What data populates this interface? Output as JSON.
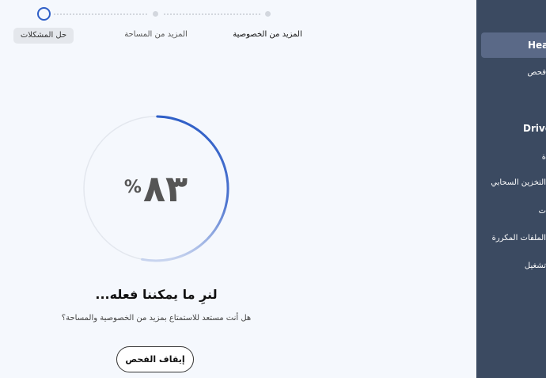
{
  "stepper": {
    "steps": [
      {
        "label": "حل المشكلات"
      },
      {
        "label": "المزيد من المساحة"
      },
      {
        "label": "المزيد من الخصوصية"
      }
    ]
  },
  "scan": {
    "percent_value": "83",
    "percent_display": "٨٣",
    "percent_sign": "%",
    "progress": 0.83,
    "headline": "لنرِ ما يمكننا فعله...",
    "subline": "هل أنت مستعد للاستمتاع بمزيد من الخصوصية والمساحة؟",
    "stop_label": "إيقاف الفحص"
  },
  "sidebar": {
    "items": [
      {
        "label": "Heal"
      },
      {
        "label": "فحص"
      },
      {
        "label": "Drive"
      },
      {
        "label": "ة"
      },
      {
        "label": "التخزين السحابي"
      },
      {
        "label": "ت"
      },
      {
        "label": "الملفات المكررة"
      },
      {
        "label": "تشغيل"
      }
    ]
  },
  "colors": {
    "accent": "#2f5fc7",
    "sidebar_bg": "#3b4a61",
    "sidebar_active": "#5a6987",
    "page_bg": "#f5f8fd"
  }
}
